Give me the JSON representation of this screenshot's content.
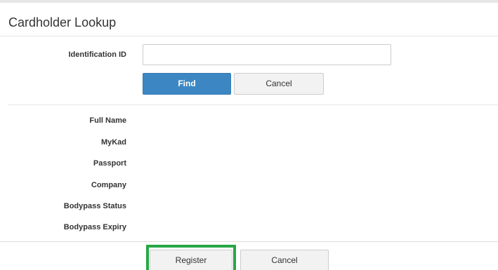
{
  "panel": {
    "title": "Cardholder Lookup"
  },
  "lookup": {
    "id_label": "Identification ID",
    "id_value": "",
    "id_placeholder": "",
    "find_label": "Find",
    "cancel_label": "Cancel"
  },
  "details": {
    "full_name_label": "Full Name",
    "mykad_label": "MyKad",
    "passport_label": "Passport",
    "company_label": "Company",
    "bodypass_status_label": "Bodypass Status",
    "bodypass_expiry_label": "Bodypass Expiry"
  },
  "footer": {
    "register_label": "Register",
    "cancel_label": "Cancel"
  },
  "colors": {
    "primary": "#3c87c3",
    "highlight": "#27a745"
  }
}
